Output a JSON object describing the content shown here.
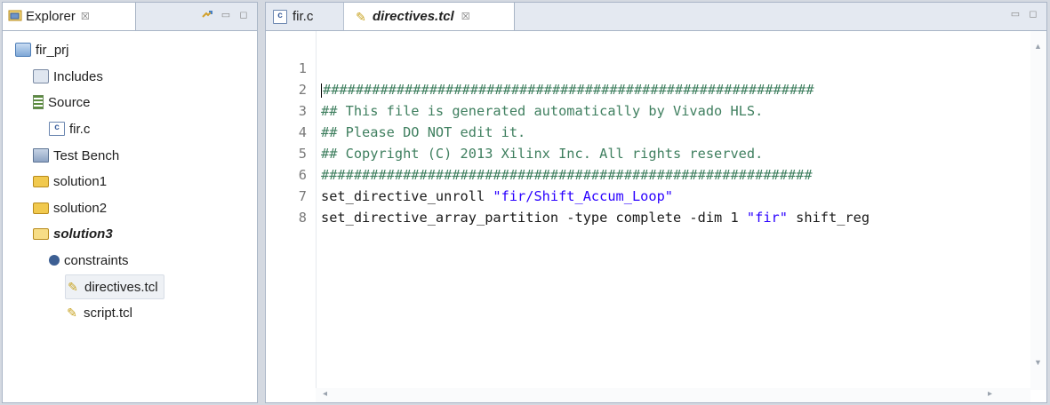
{
  "explorer": {
    "tab_label": "Explorer",
    "tab_close_glyph": "☒",
    "minimize_glyph": "▭",
    "maximize_glyph": "◻",
    "tree": [
      {
        "label": "fir_prj",
        "icon": "project-icon"
      },
      {
        "label": "Includes",
        "icon": "includes-icon"
      },
      {
        "label": "Source",
        "icon": "source-icon"
      },
      {
        "label": "fir.c",
        "icon": "c-file-icon"
      },
      {
        "label": "Test Bench",
        "icon": "test-bench-icon"
      },
      {
        "label": "solution1",
        "icon": "folder-icon"
      },
      {
        "label": "solution2",
        "icon": "folder-icon"
      },
      {
        "label": "solution3",
        "icon": "folder-open-icon",
        "active": true
      },
      {
        "label": "constraints",
        "icon": "gear-icon"
      },
      {
        "label": "directives.tcl",
        "icon": "tcl-file-icon",
        "selected": true
      },
      {
        "label": "script.tcl",
        "icon": "tcl-file-icon"
      }
    ]
  },
  "editor": {
    "tabs": [
      {
        "label": "fir.c",
        "icon": "c-file-icon"
      },
      {
        "label": "directives.tcl",
        "icon": "tcl-file-icon",
        "active": true
      }
    ],
    "tab_close_glyph": "☒",
    "minimize_glyph": "▭",
    "maximize_glyph": "◻",
    "lines": [
      {
        "n": "1",
        "text": "############################################################"
      },
      {
        "n": "2",
        "text": "## This file is generated automatically by Vivado HLS."
      },
      {
        "n": "3",
        "text": "## Please DO NOT edit it."
      },
      {
        "n": "4",
        "text": "## Copyright (C) 2013 Xilinx Inc. All rights reserved."
      },
      {
        "n": "5",
        "text": "############################################################"
      },
      {
        "n": "6",
        "pre": "set_directive_unroll ",
        "str": "\"fir/Shift_Accum_Loop\"",
        "post": ""
      },
      {
        "n": "7",
        "pre": "set_directive_array_partition -type complete -dim 1 ",
        "str": "\"fir\"",
        "post": " shift_reg"
      },
      {
        "n": "8",
        "text": ""
      }
    ],
    "scroll_up_glyph": "▲",
    "scroll_down_glyph": "▼",
    "scroll_left_glyph": "◂",
    "scroll_right_glyph": "▸"
  },
  "colors": {
    "comment": "#3f7f5f",
    "string": "#2a00ff",
    "panel_border": "#a9b5c6",
    "tab_bar": "#e4e9f1"
  }
}
